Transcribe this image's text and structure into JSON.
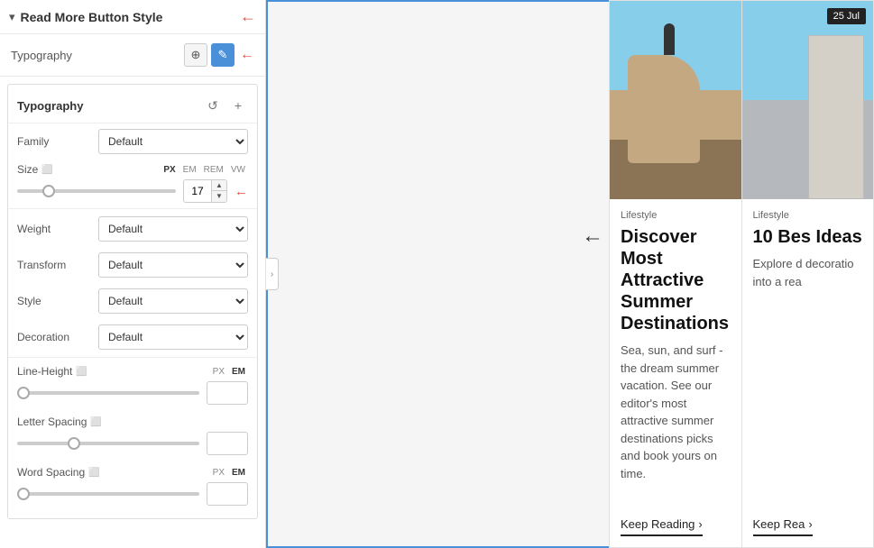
{
  "panel": {
    "header_title": "Read More Button Style",
    "typography_section_label": "Typography",
    "globe_icon": "🌐",
    "edit_icon": "✏",
    "typography_box_title": "Typography",
    "reset_icon": "↺",
    "plus_icon": "+",
    "family_label": "Family",
    "family_default": "Default",
    "size_label": "Size",
    "size_units": [
      "PX",
      "EM",
      "REM",
      "VW"
    ],
    "size_active_unit": "PX",
    "size_value": "17",
    "weight_label": "Weight",
    "weight_default": "Default",
    "transform_label": "Transform",
    "transform_default": "Default",
    "style_label": "Style",
    "style_default": "Default",
    "decoration_label": "Decoration",
    "decoration_default": "Default",
    "line_height_label": "Line-Height",
    "line_height_units": [
      "PX",
      "EM"
    ],
    "letter_spacing_label": "Letter Spacing",
    "word_spacing_label": "Word Spacing",
    "word_spacing_units": [
      "PX",
      "EM"
    ]
  },
  "cards": [
    {
      "category": "Lifestyle",
      "title": "Discover Most Attractive Summer Destinations",
      "excerpt": "Sea, sun, and surf - the dream summer vacation. See our editor's most attractive summer destinations picks and book yours on time.",
      "read_more": "Keep Reading",
      "date_badge": ""
    },
    {
      "category": "Lifestyle",
      "title": "10 Bes Ideas",
      "excerpt": "Explore d decoratio into a rea",
      "read_more": "Keep Rea",
      "date_badge": "25 Jul"
    }
  ],
  "back_arrow": "←",
  "collapse_handle": "›"
}
